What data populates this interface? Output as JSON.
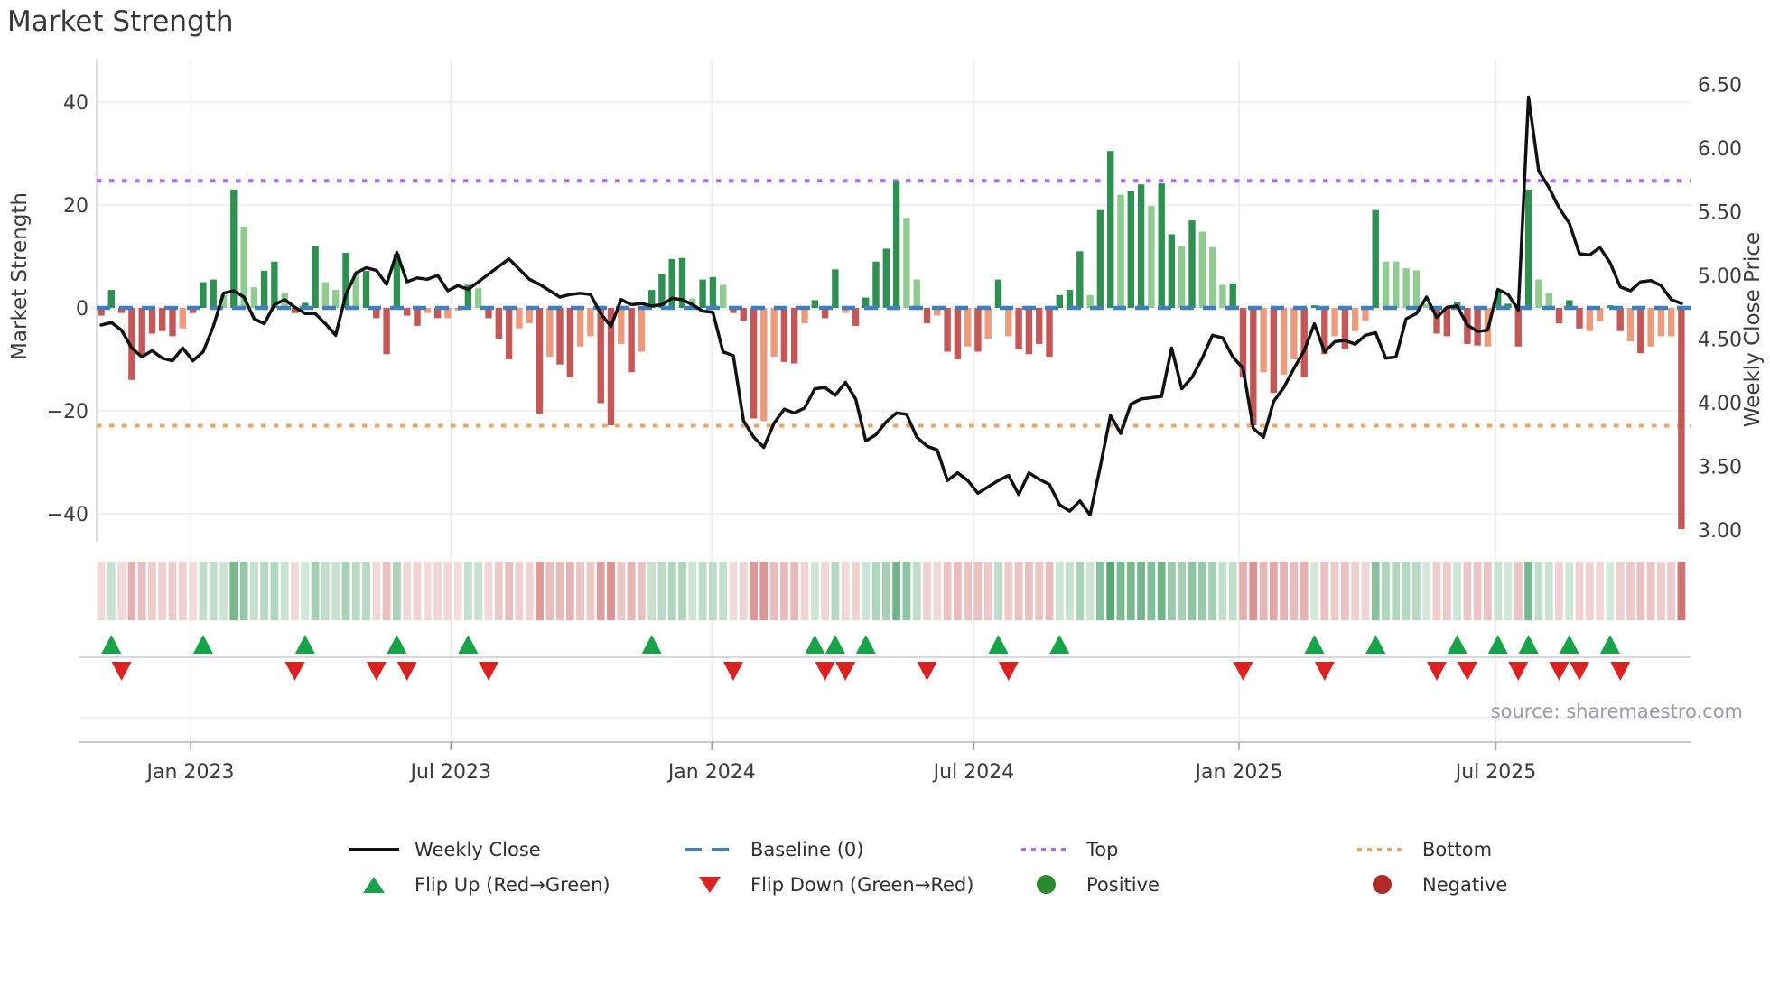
{
  "title": "Market Strength",
  "source": "source: sharemaestro.com",
  "axes": {
    "left_title": "Market Strength",
    "right_title": "Weekly Close Price",
    "left_ticks": [
      {
        "label": "40",
        "value": 40
      },
      {
        "label": "20",
        "value": 20
      },
      {
        "label": "0",
        "value": 0
      },
      {
        "label": "−20",
        "value": -20
      },
      {
        "label": "−40",
        "value": -40
      }
    ],
    "right_ticks": [
      {
        "label": "6.50",
        "value": 6.5
      },
      {
        "label": "6.00",
        "value": 6.0
      },
      {
        "label": "5.50",
        "value": 5.5
      },
      {
        "label": "5.00",
        "value": 5.0
      },
      {
        "label": "4.50",
        "value": 4.5
      },
      {
        "label": "4.00",
        "value": 4.0
      },
      {
        "label": "3.50",
        "value": 3.5
      },
      {
        "label": "3.00",
        "value": 3.0
      }
    ],
    "x_ticks": [
      {
        "label": "Jan 2023",
        "week": 8.77
      },
      {
        "label": "Jul 2023",
        "week": 34.3
      },
      {
        "label": "Jan 2024",
        "week": 59.9
      },
      {
        "label": "Jul 2024",
        "week": 85.6
      },
      {
        "label": "Jan 2025",
        "week": 111.6
      },
      {
        "label": "Jul 2025",
        "week": 136.8
      }
    ],
    "left_ylim": [
      -45,
      48
    ],
    "right_ylim": [
      2.95,
      6.55
    ]
  },
  "reference_lines": {
    "baseline": {
      "label": "Baseline (0)",
      "value": 0,
      "color": "#3f7fbf",
      "style": "dashed"
    },
    "top": {
      "label": "Top",
      "value": 24.7,
      "color": "#ad6bf0",
      "style": "dotted"
    },
    "bottom": {
      "label": "Bottom",
      "value": -22.9,
      "color": "#f2a360",
      "style": "dotted"
    }
  },
  "colors": {
    "bar_pos_dark": "#2e9152",
    "bar_pos_light": "#90cb90",
    "bar_neg_dark": "#c65757",
    "bar_neg_light": "#ec9b7c",
    "flip_up": "#17a347",
    "flip_down": "#dd2020",
    "positive_dot": "#2c8a2c",
    "negative_dot": "#b02a2a",
    "price_line": "#111111",
    "grid": "#ebebf0",
    "vgrid": "#ededf2",
    "spine": "#d4d4da",
    "axis_line": "#c9c9cf",
    "tick_text": "#3b3b3b"
  },
  "legend": {
    "rows": [
      {
        "items": [
          {
            "icon": "line-swatch",
            "label": "Weekly Close"
          },
          {
            "icon": "dash-swatch",
            "label": "Baseline (0)"
          },
          {
            "icon": "dots-swatch",
            "label": "Top"
          },
          {
            "icon": "dots-swatch",
            "label": "Bottom"
          }
        ]
      },
      {
        "items": [
          {
            "icon": "triangle-up",
            "label": "Flip Up (Red→Green)"
          },
          {
            "icon": "triangle-down",
            "label": "Flip Down (Green→Red)"
          },
          {
            "icon": "circle",
            "label": "Positive"
          },
          {
            "icon": "circle",
            "label": "Negative"
          }
        ]
      }
    ]
  },
  "chart_data": {
    "type": "combo-bar-line-heatmap",
    "description": "Weekly market strength bars (left axis), weekly close price line (right axis), heatmap strip of weekly strength, and flip markers where bar sign changes.",
    "x_unit": "week",
    "start_label": "Nov 2022",
    "end_label": "Oct 2025",
    "price_baseline": 4.745,
    "strength": [
      -1.5,
      3.5,
      -1,
      -14,
      -9.5,
      -5,
      -4.5,
      -5.5,
      -4,
      -1,
      5,
      5.5,
      2.5,
      23,
      15.8,
      4,
      7.2,
      9,
      3,
      -1,
      1,
      12,
      5,
      3.5,
      10.7,
      6.9,
      7.2,
      -2,
      -9,
      10.5,
      -1.5,
      -3.5,
      -1,
      -2,
      -2,
      -0.5,
      4.5,
      3.8,
      -2,
      -6,
      -10,
      -4,
      -3,
      -20.5,
      -9.5,
      -11,
      -13.5,
      -7.5,
      -5.5,
      -18.5,
      -22.8,
      -7,
      -12.5,
      -8.5,
      3.5,
      6.5,
      9.5,
      9.7,
      1.8,
      5.5,
      6,
      4.5,
      -1,
      -2.5,
      -21.5,
      -22,
      -9.5,
      -10.5,
      -10.8,
      -3,
      1.5,
      -2,
      7.5,
      -1,
      -3.5,
      2,
      9,
      11.5,
      24.5,
      17.5,
      5.5,
      -3,
      -1.5,
      -8.5,
      -10,
      -7.5,
      -8.5,
      -6,
      5.5,
      -5.5,
      -8,
      -9,
      -7,
      -9.5,
      2.5,
      3.5,
      11,
      2.5,
      19,
      30.5,
      22,
      22.7,
      24,
      19.8,
      24.2,
      14.3,
      12,
      17,
      14.8,
      11.8,
      4.5,
      4.7,
      -13.5,
      -22.8,
      -12.5,
      -16.5,
      -13,
      -10,
      -13.5,
      0.5,
      -9,
      -5.5,
      -8,
      -4.5,
      -2.5,
      19,
      9,
      9,
      7.7,
      7.3,
      0.8,
      -5,
      -5.5,
      1.2,
      -7,
      -7.3,
      -7.5,
      3.3,
      0.8,
      -7.5,
      23,
      5.5,
      3,
      -3,
      1.5,
      -4,
      -4.5,
      -2.5,
      0.5,
      -4.5,
      -6.5,
      -8.8,
      -7.5,
      -5.5,
      -5.5,
      -43
    ],
    "light_shade_indices": [
      8,
      12,
      14,
      15,
      18,
      22,
      23,
      25,
      32,
      34,
      35,
      37,
      41,
      42,
      44,
      47,
      48,
      51,
      53,
      58,
      61,
      65,
      66,
      69,
      73,
      79,
      80,
      82,
      85,
      87,
      89,
      97,
      100,
      103,
      106,
      108,
      109,
      110,
      114,
      116,
      117,
      121,
      123,
      124,
      126,
      127,
      128,
      129,
      130,
      136,
      141,
      142,
      146,
      147,
      150,
      152,
      153,
      154
    ],
    "close": [
      4.61,
      4.63,
      4.57,
      4.43,
      4.36,
      4.41,
      4.35,
      4.33,
      4.43,
      4.33,
      4.4,
      4.6,
      4.86,
      4.88,
      4.83,
      4.66,
      4.62,
      4.77,
      4.81,
      4.75,
      4.7,
      4.7,
      4.62,
      4.53,
      4.85,
      5.02,
      5.06,
      5.04,
      4.93,
      5.18,
      4.95,
      4.98,
      4.97,
      5.0,
      4.88,
      4.92,
      4.89,
      4.95,
      5.01,
      5.07,
      5.13,
      5.05,
      4.97,
      4.93,
      4.88,
      4.83,
      4.85,
      4.86,
      4.85,
      4.7,
      4.6,
      4.81,
      4.77,
      4.78,
      4.76,
      4.77,
      4.82,
      4.81,
      4.77,
      4.72,
      4.71,
      4.4,
      4.37,
      3.86,
      3.73,
      3.65,
      3.84,
      3.95,
      3.92,
      3.96,
      4.11,
      4.12,
      4.06,
      4.16,
      4.03,
      3.7,
      3.75,
      3.85,
      3.92,
      3.91,
      3.73,
      3.66,
      3.63,
      3.39,
      3.45,
      3.39,
      3.29,
      3.34,
      3.39,
      3.43,
      3.28,
      3.45,
      3.4,
      3.36,
      3.2,
      3.15,
      3.23,
      3.12,
      3.5,
      3.9,
      3.76,
      3.99,
      4.03,
      4.04,
      4.05,
      4.43,
      4.11,
      4.2,
      4.35,
      4.53,
      4.51,
      4.36,
      4.27,
      3.8,
      3.73,
      4.01,
      4.12,
      4.27,
      4.41,
      4.62,
      4.4,
      4.48,
      4.49,
      4.46,
      4.53,
      4.55,
      4.35,
      4.36,
      4.66,
      4.7,
      4.83,
      4.67,
      4.75,
      4.76,
      4.61,
      4.56,
      4.57,
      4.89,
      4.85,
      4.73,
      6.4,
      5.82,
      5.69,
      5.53,
      5.41,
      5.17,
      5.16,
      5.22,
      5.1,
      4.91,
      4.88,
      4.95,
      4.96,
      4.92,
      4.81,
      4.78
    ]
  }
}
